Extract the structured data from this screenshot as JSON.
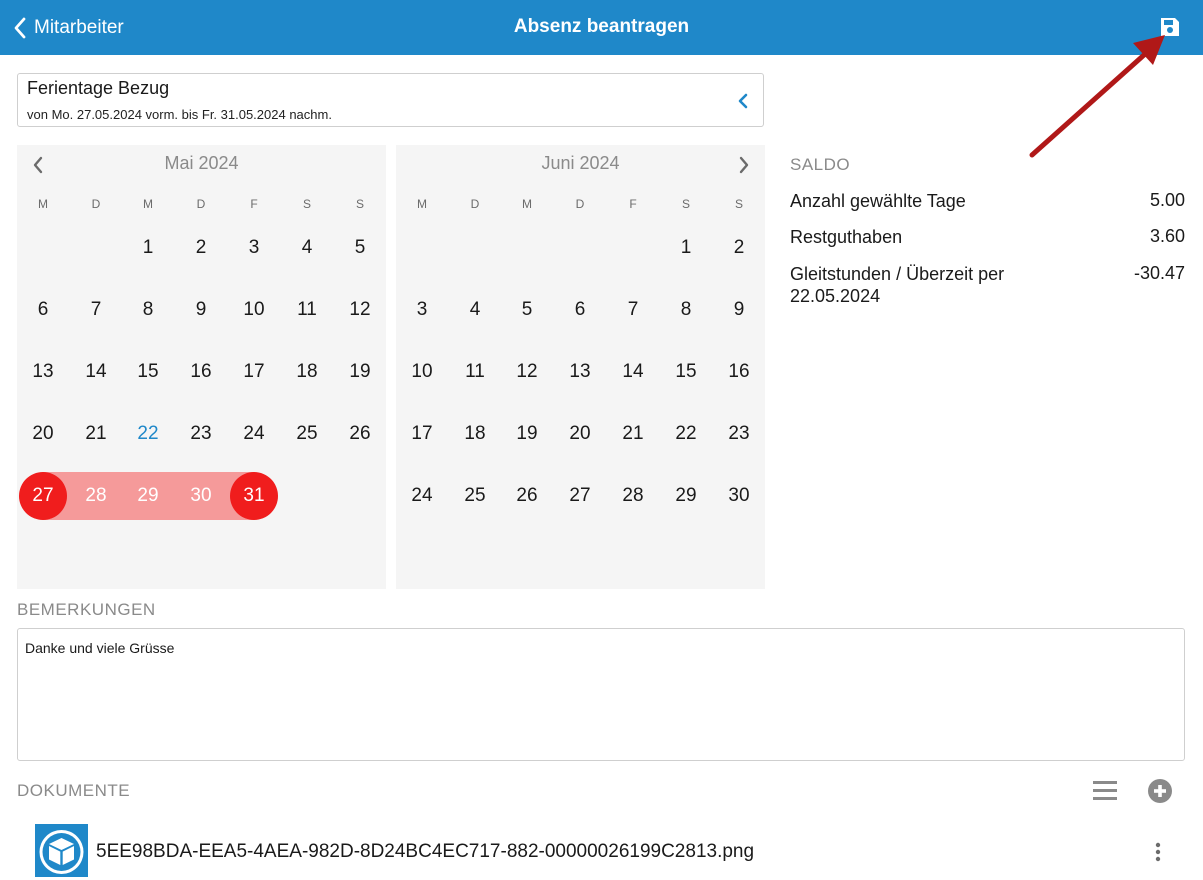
{
  "nav": {
    "back_label": "Mitarbeiter",
    "title": "Absenz beantragen",
    "color": "#1f88c9"
  },
  "absence": {
    "type_label": "Ferientage Bezug",
    "range_text": "von Mo. 27.05.2024 vorm. bis Fr. 31.05.2024 nachm."
  },
  "calendar": {
    "weekdays": [
      "M",
      "D",
      "M",
      "D",
      "F",
      "S",
      "S"
    ],
    "months": [
      {
        "title": "Mai 2024",
        "weeks": [
          [
            "",
            "",
            "1",
            "2",
            "3",
            "4",
            "5"
          ],
          [
            "6",
            "7",
            "8",
            "9",
            "10",
            "11",
            "12"
          ],
          [
            "13",
            "14",
            "15",
            "16",
            "17",
            "18",
            "19"
          ],
          [
            "20",
            "21",
            "22",
            "23",
            "24",
            "25",
            "26"
          ],
          [
            "27",
            "28",
            "29",
            "30",
            "31",
            "",
            ""
          ]
        ],
        "today": "22",
        "selection": {
          "start": "27",
          "end": "31"
        }
      },
      {
        "title": "Juni 2024",
        "weeks": [
          [
            "",
            "",
            "",
            "",
            "",
            "1",
            "2"
          ],
          [
            "3",
            "4",
            "5",
            "6",
            "7",
            "8",
            "9"
          ],
          [
            "10",
            "11",
            "12",
            "13",
            "14",
            "15",
            "16"
          ],
          [
            "17",
            "18",
            "19",
            "20",
            "21",
            "22",
            "23"
          ],
          [
            "24",
            "25",
            "26",
            "27",
            "28",
            "29",
            "30"
          ]
        ]
      }
    ],
    "selection_color": "#f01d1d",
    "selection_band_color": "#f59a9a",
    "today_color": "#1f88c9"
  },
  "saldo": {
    "heading": "SALDO",
    "rows": [
      {
        "label": "Anzahl gewählte Tage",
        "value": "5.00"
      },
      {
        "label": "Restguthaben",
        "value": "3.60"
      },
      {
        "label": "Gleitstunden / Überzeit per 22.05.2024",
        "value": "-30.47"
      }
    ]
  },
  "remarks": {
    "heading": "BEMERKUNGEN",
    "text": "Danke und viele Grüsse"
  },
  "documents": {
    "heading": "DOKUMENTE",
    "items": [
      {
        "name": "5EE98BDA-EEA5-4AEA-982D-8D24BC4EC717-882-00000026199C2813.png",
        "icon": "box-icon"
      }
    ]
  },
  "icons": {
    "back": "chevron-left-icon",
    "save": "save-icon",
    "collapse": "chevron-left-icon",
    "prev_month": "chevron-left-icon",
    "next_month": "chevron-right-icon",
    "list": "list-icon",
    "add": "plus-circle-icon",
    "more": "more-vertical-icon",
    "annotation": "red-arrow-icon"
  }
}
